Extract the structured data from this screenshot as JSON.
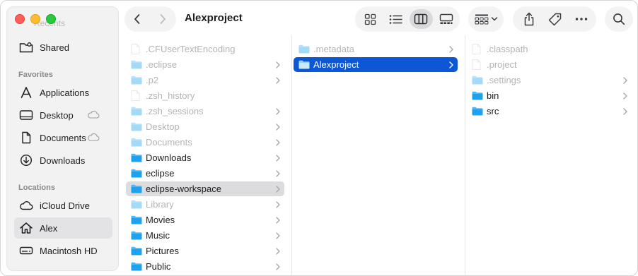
{
  "window": {
    "title": "Alexproject"
  },
  "sidebar": {
    "faded_top": "Recents",
    "shared": {
      "label": "Shared",
      "icon": "shared-folder-icon"
    },
    "favorites_title": "Favorites",
    "favorites": [
      {
        "label": "Applications",
        "icon": "applications-icon",
        "cloud": false
      },
      {
        "label": "Desktop",
        "icon": "desktop-icon",
        "cloud": true
      },
      {
        "label": "Documents",
        "icon": "document-icon",
        "cloud": true
      },
      {
        "label": "Downloads",
        "icon": "download-icon",
        "cloud": false
      }
    ],
    "locations_title": "Locations",
    "locations": [
      {
        "label": "iCloud Drive",
        "icon": "cloud-icon"
      },
      {
        "label": "Alex",
        "icon": "home-icon"
      },
      {
        "label": "Macintosh HD",
        "icon": "disk-icon"
      }
    ]
  },
  "columns": {
    "col1": [
      {
        "label": ".CFUserTextEncoding",
        "type": "file",
        "dim": true,
        "chevron": false
      },
      {
        "label": ".eclipse",
        "type": "folder",
        "dim": true,
        "chevron": true
      },
      {
        "label": ".p2",
        "type": "folder",
        "dim": true,
        "chevron": true
      },
      {
        "label": ".zsh_history",
        "type": "file",
        "dim": true,
        "chevron": false
      },
      {
        "label": ".zsh_sessions",
        "type": "folder",
        "dim": true,
        "chevron": true
      },
      {
        "label": "Desktop",
        "type": "folder",
        "dim": true,
        "chevron": true
      },
      {
        "label": "Documents",
        "type": "folder",
        "dim": true,
        "chevron": true
      },
      {
        "label": "Downloads",
        "type": "folder",
        "dim": false,
        "chevron": true
      },
      {
        "label": "eclipse",
        "type": "folder",
        "dim": false,
        "chevron": true
      },
      {
        "label": "eclipse-workspace",
        "type": "folder",
        "dim": false,
        "chevron": true,
        "selected": "gray"
      },
      {
        "label": "Library",
        "type": "folder",
        "dim": true,
        "chevron": true
      },
      {
        "label": "Movies",
        "type": "folder",
        "dim": false,
        "chevron": true
      },
      {
        "label": "Music",
        "type": "folder",
        "dim": false,
        "chevron": true
      },
      {
        "label": "Pictures",
        "type": "folder",
        "dim": false,
        "chevron": true
      },
      {
        "label": "Public",
        "type": "folder",
        "dim": false,
        "chevron": true
      }
    ],
    "col2": [
      {
        "label": ".metadata",
        "type": "folder",
        "dim": true,
        "chevron": true
      },
      {
        "label": "Alexproject",
        "type": "folder",
        "dim": false,
        "chevron": true,
        "selected": "blue"
      }
    ],
    "col3": [
      {
        "label": ".classpath",
        "type": "file",
        "dim": true,
        "chevron": false
      },
      {
        "label": ".project",
        "type": "file",
        "dim": true,
        "chevron": false
      },
      {
        "label": ".settings",
        "type": "folder",
        "dim": true,
        "chevron": true
      },
      {
        "label": "bin",
        "type": "folder",
        "dim": false,
        "chevron": true
      },
      {
        "label": "src",
        "type": "folder",
        "dim": false,
        "chevron": true
      }
    ]
  },
  "colors": {
    "selection_blue": "#0b57d6",
    "selection_gray": "#dcdcde",
    "folder_blue": "#1fa1ee",
    "close": "#fe5f57",
    "minimize": "#febc2e",
    "maximize": "#28c840"
  }
}
